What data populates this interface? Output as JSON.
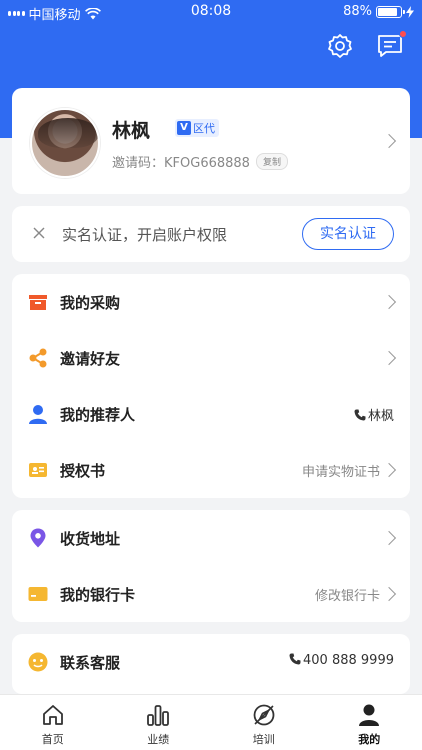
{
  "status_bar": {
    "carrier": "中国移动",
    "time": "08:08",
    "battery": "88%",
    "battery_level": 0.88
  },
  "profile": {
    "name": "林枫",
    "level_badge": "区代",
    "invite_label": "邀请码：",
    "invite_code": "KFOG668888",
    "copy_label": "复制"
  },
  "verify": {
    "text": "实名认证，开启账户权限",
    "button": "实名认证"
  },
  "menu1": {
    "items": [
      {
        "label": "我的采购",
        "value": ""
      },
      {
        "label": "邀请好友",
        "value": ""
      },
      {
        "label": "我的推荐人",
        "value": "林枫"
      },
      {
        "label": "授权书",
        "value": "申请实物证书"
      }
    ]
  },
  "menu2": {
    "items": [
      {
        "label": "收货地址",
        "value": ""
      },
      {
        "label": "我的银行卡",
        "value": "修改银行卡"
      }
    ]
  },
  "menu3": {
    "items": [
      {
        "label": "联系客服",
        "value": "400 888 9999"
      }
    ]
  },
  "tabbar": {
    "items": [
      {
        "label": "首页"
      },
      {
        "label": "业绩"
      },
      {
        "label": "培训"
      },
      {
        "label": "我的"
      }
    ],
    "active": "我的"
  },
  "colors": {
    "primary": "#2f6bf2",
    "purchase_icon": "#f0592a",
    "invite_icon": "#f39a2b",
    "referrer_icon": "#2f6bf2",
    "cert_icon": "#f5b731",
    "address_icon": "#7a56e6",
    "bank_icon": "#f5b731",
    "service_icon": "#f5b731"
  }
}
